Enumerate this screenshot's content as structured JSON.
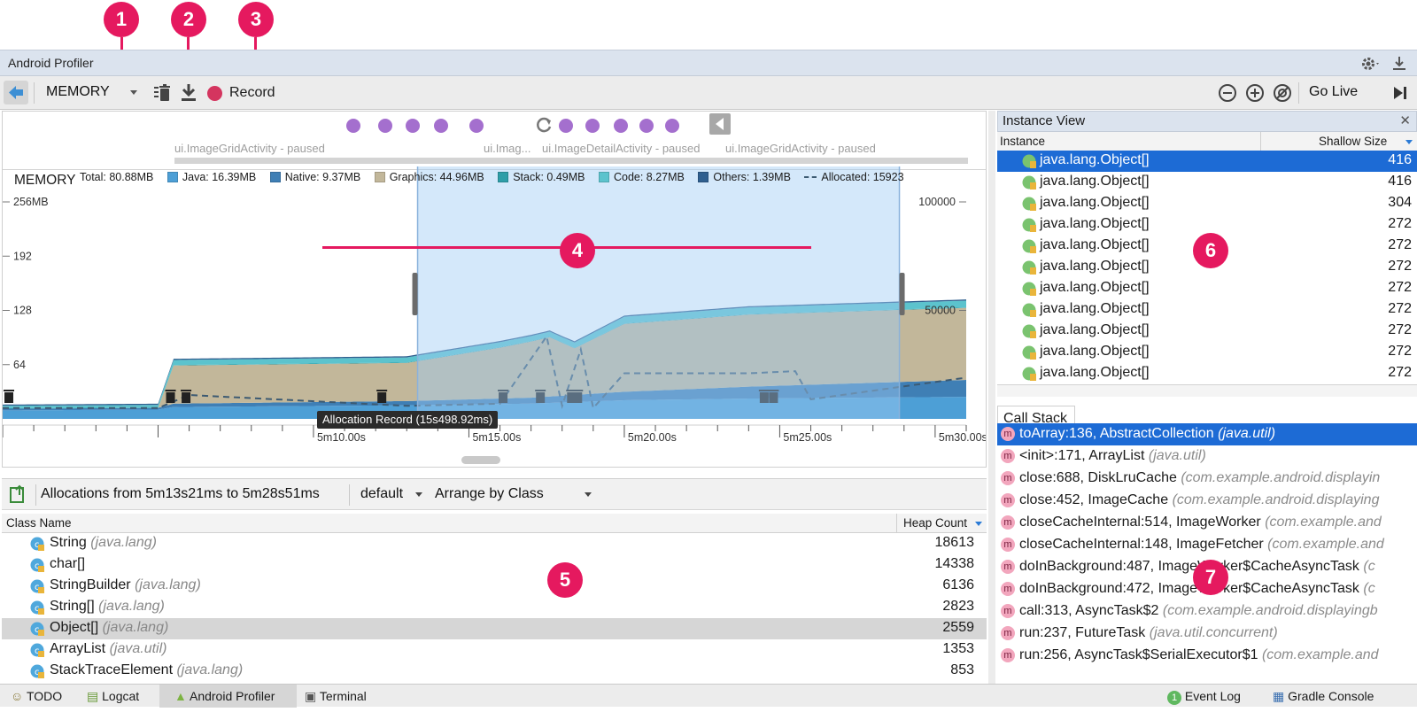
{
  "callouts": [
    "1",
    "2",
    "3",
    "4",
    "5",
    "6",
    "7"
  ],
  "window": {
    "title": "Android Profiler"
  },
  "toolbar": {
    "profiler_dropdown": "MEMORY",
    "record_label": "Record",
    "go_live_label": "Go Live"
  },
  "events": {
    "activities": [
      "ui.ImageGridActivity - paused",
      "ui.Imag...",
      "ui.ImageDetailActivity - paused",
      "ui.ImageGridActivity - paused"
    ]
  },
  "memory": {
    "title": "MEMORY",
    "legend": [
      {
        "label": "Total: 80.88MB",
        "color": ""
      },
      {
        "label": "Java: 16.39MB",
        "color": "#4d9fd6"
      },
      {
        "label": "Native: 9.37MB",
        "color": "#3f7fb5"
      },
      {
        "label": "Graphics: 44.96MB",
        "color": "#c2b79a"
      },
      {
        "label": "Stack: 0.49MB",
        "color": "#2e9ea8"
      },
      {
        "label": "Code: 8.27MB",
        "color": "#5cc3cd"
      },
      {
        "label": "Others: 1.39MB",
        "color": "#2f5f8f"
      },
      {
        "label": "Allocated: 15923",
        "color": "#3c5a72"
      }
    ],
    "selection_tooltip": "Allocation Record (15s498.92ms)"
  },
  "chart_data": {
    "type": "area",
    "title": "MEMORY",
    "y_left_ticks": [
      "256MB",
      "192",
      "128",
      "64"
    ],
    "y_right_ticks": [
      "100000",
      "50000"
    ],
    "x_ticks": [
      "5m10.00s",
      "5m15.00s",
      "5m20.00s",
      "5m25.00s",
      "5m30.00s"
    ],
    "x_range_s": [
      300,
      331
    ],
    "y_left_range_mb": [
      0,
      256
    ],
    "selection_range_s": [
      313.35,
      328.85
    ],
    "series": [
      {
        "name": "Java",
        "color": "#4d9fd6",
        "x": [
          300,
          305,
          305.5,
          313,
          317,
          320,
          324,
          331
        ],
        "y": [
          10,
          11,
          14,
          16,
          18,
          22,
          24,
          26
        ]
      },
      {
        "name": "Native",
        "color": "#3f7fb5",
        "x": [
          300,
          305,
          305.5,
          313,
          317,
          320,
          324,
          331
        ],
        "y": [
          2,
          2,
          4,
          5,
          7,
          10,
          14,
          20
        ]
      },
      {
        "name": "Graphics",
        "color": "#c2b79a",
        "x": [
          300,
          305,
          305.5,
          313,
          316,
          317.6,
          318.4,
          320,
          324,
          331
        ],
        "y": [
          0,
          0,
          45,
          45,
          60,
          70,
          55,
          80,
          85,
          85
        ]
      },
      {
        "name": "Stack",
        "color": "#2e9ea8",
        "x": [
          300,
          331
        ],
        "y": [
          0.5,
          0.5
        ]
      },
      {
        "name": "Code",
        "color": "#5cc3cd",
        "x": [
          300,
          305,
          305.5,
          313,
          318,
          320,
          331
        ],
        "y": [
          3,
          3,
          6,
          6,
          6,
          8,
          8
        ]
      },
      {
        "name": "Others",
        "color": "#2f5f8f",
        "x": [
          300,
          331
        ],
        "y": [
          1.4,
          1.4
        ]
      }
    ],
    "allocated_series": {
      "name": "Allocated",
      "x": [
        300,
        305,
        306,
        313,
        316,
        317.5,
        318,
        318.6,
        319,
        320,
        324,
        325.5,
        326,
        331
      ],
      "y": [
        5000,
        5000,
        11000,
        6000,
        7000,
        38000,
        6000,
        32000,
        5000,
        21000,
        21000,
        22000,
        9000,
        19000
      ]
    },
    "gc_events_s": [
      300.2,
      305.4,
      305.9,
      312.2,
      316.1,
      317.3,
      318.3,
      318.5,
      324.5,
      324.8
    ]
  },
  "allocations": {
    "range_label": "Allocations from 5m13s21ms to 5m28s51ms",
    "heap_select": "default",
    "arrange_select": "Arrange by Class",
    "columns": {
      "class_name": "Class Name",
      "heap_count": "Heap Count"
    },
    "rows": [
      {
        "name": "String",
        "pkg": "(java.lang)",
        "count": "18613"
      },
      {
        "name": "char[]",
        "pkg": "",
        "count": "14338"
      },
      {
        "name": "StringBuilder",
        "pkg": "(java.lang)",
        "count": "6136"
      },
      {
        "name": "String[]",
        "pkg": "(java.lang)",
        "count": "2823"
      },
      {
        "name": "Object[]",
        "pkg": "(java.lang)",
        "count": "2559"
      },
      {
        "name": "ArrayList",
        "pkg": "(java.util)",
        "count": "1353"
      },
      {
        "name": "StackTraceElement",
        "pkg": "(java.lang)",
        "count": "853"
      }
    ]
  },
  "instance_view": {
    "title": "Instance View",
    "columns": {
      "instance": "Instance",
      "shallow_size": "Shallow Size"
    },
    "rows": [
      {
        "name": "java.lang.Object[]",
        "size": "416"
      },
      {
        "name": "java.lang.Object[]",
        "size": "416"
      },
      {
        "name": "java.lang.Object[]",
        "size": "304"
      },
      {
        "name": "java.lang.Object[]",
        "size": "272"
      },
      {
        "name": "java.lang.Object[]",
        "size": "272"
      },
      {
        "name": "java.lang.Object[]",
        "size": "272"
      },
      {
        "name": "java.lang.Object[]",
        "size": "272"
      },
      {
        "name": "java.lang.Object[]",
        "size": "272"
      },
      {
        "name": "java.lang.Object[]",
        "size": "272"
      },
      {
        "name": "java.lang.Object[]",
        "size": "272"
      },
      {
        "name": "java.lang.Object[]",
        "size": "272"
      }
    ]
  },
  "call_stack": {
    "tab": "Call Stack",
    "frames": [
      {
        "method": "toArray:136, AbstractCollection",
        "pkg": "(java.util)"
      },
      {
        "method": "<init>:171, ArrayList",
        "pkg": "(java.util)"
      },
      {
        "method": "close:688, DiskLruCache",
        "pkg": "(com.example.android.displayin"
      },
      {
        "method": "close:452, ImageCache",
        "pkg": "(com.example.android.displaying"
      },
      {
        "method": "closeCacheInternal:514, ImageWorker",
        "pkg": "(com.example.and"
      },
      {
        "method": "closeCacheInternal:148, ImageFetcher",
        "pkg": "(com.example.and"
      },
      {
        "method": "doInBackground:487, ImageWorker$CacheAsyncTask",
        "pkg": "(c"
      },
      {
        "method": "doInBackground:472, ImageWorker$CacheAsyncTask",
        "pkg": "(c"
      },
      {
        "method": "call:313, AsyncTask$2",
        "pkg": "(com.example.android.displayingb"
      },
      {
        "method": "run:237, FutureTask",
        "pkg": "(java.util.concurrent)"
      },
      {
        "method": "run:256, AsyncTask$SerialExecutor$1",
        "pkg": "(com.example.and"
      }
    ]
  },
  "statusbar": {
    "todo": "TODO",
    "logcat": "Logcat",
    "profiler": "Android Profiler",
    "terminal": "Terminal",
    "event_log_badge": "1",
    "event_log": "Event Log",
    "gradle_console": "Gradle Console"
  }
}
